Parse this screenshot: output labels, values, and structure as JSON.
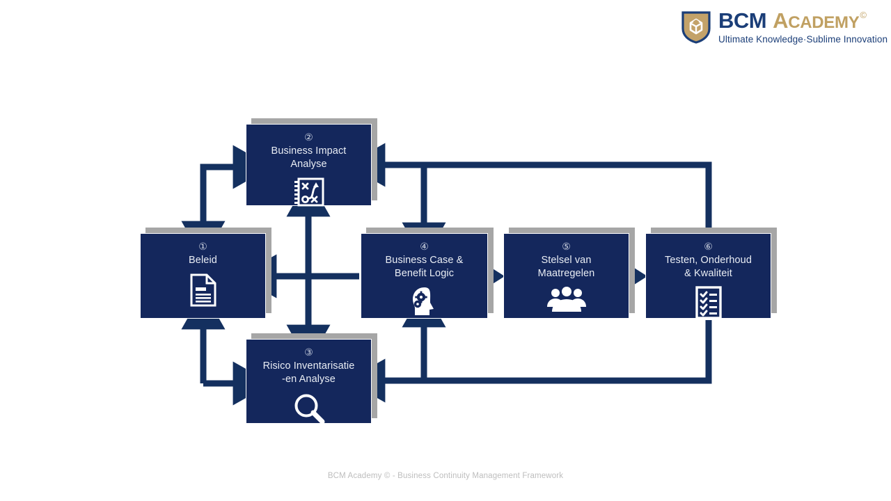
{
  "logo": {
    "name": "BCM Academy",
    "word_bcm": "BCM",
    "word_academy_cap": "A",
    "word_academy_rest": "CADEMY",
    "registered_mark": "©",
    "tagline": "Ultimate Knowledge·Sublime Innovation",
    "shield_icon": "bcm-shield-cube-logo",
    "brand_navy": "#1b3e78",
    "brand_gold": "#c0a062"
  },
  "diagram": {
    "title": "Business Continuity Management Framework",
    "box_fill": "#14275c",
    "box_shadow": "#a6a6a6",
    "arrow_color": "#14305f",
    "nodes": [
      {
        "number": "①",
        "label": "Beleid",
        "icon": "document-icon",
        "name": "node-beleid"
      },
      {
        "number": "②",
        "label_line1": "Business Impact",
        "label_line2": "Analyse",
        "icon": "strategy-playbook-icon",
        "name": "node-business-impact-analyse"
      },
      {
        "number": "③",
        "label_line1": "Risico Inventarisatie",
        "label_line2": "-en Analyse",
        "icon": "magnifier-icon",
        "name": "node-risico-inventarisatie-en-analyse"
      },
      {
        "number": "④",
        "label_line1": "Business Case &",
        "label_line2": "Benefit Logic",
        "icon": "head-gears-icon",
        "name": "node-business-case-benefit-logic"
      },
      {
        "number": "⑤",
        "label_line1": "Stelsel van",
        "label_line2": "Maatregelen",
        "icon": "people-group-icon",
        "name": "node-stelsel-van-maatregelen"
      },
      {
        "number": "⑥",
        "label_line1": "Testen, Onderhoud",
        "label_line2": "& Kwaliteit",
        "icon": "checklist-icon",
        "name": "node-testen-onderhoud-kwaliteit"
      }
    ]
  },
  "footer": {
    "text": "BCM Academy © - Business Continuity Management Framework"
  }
}
